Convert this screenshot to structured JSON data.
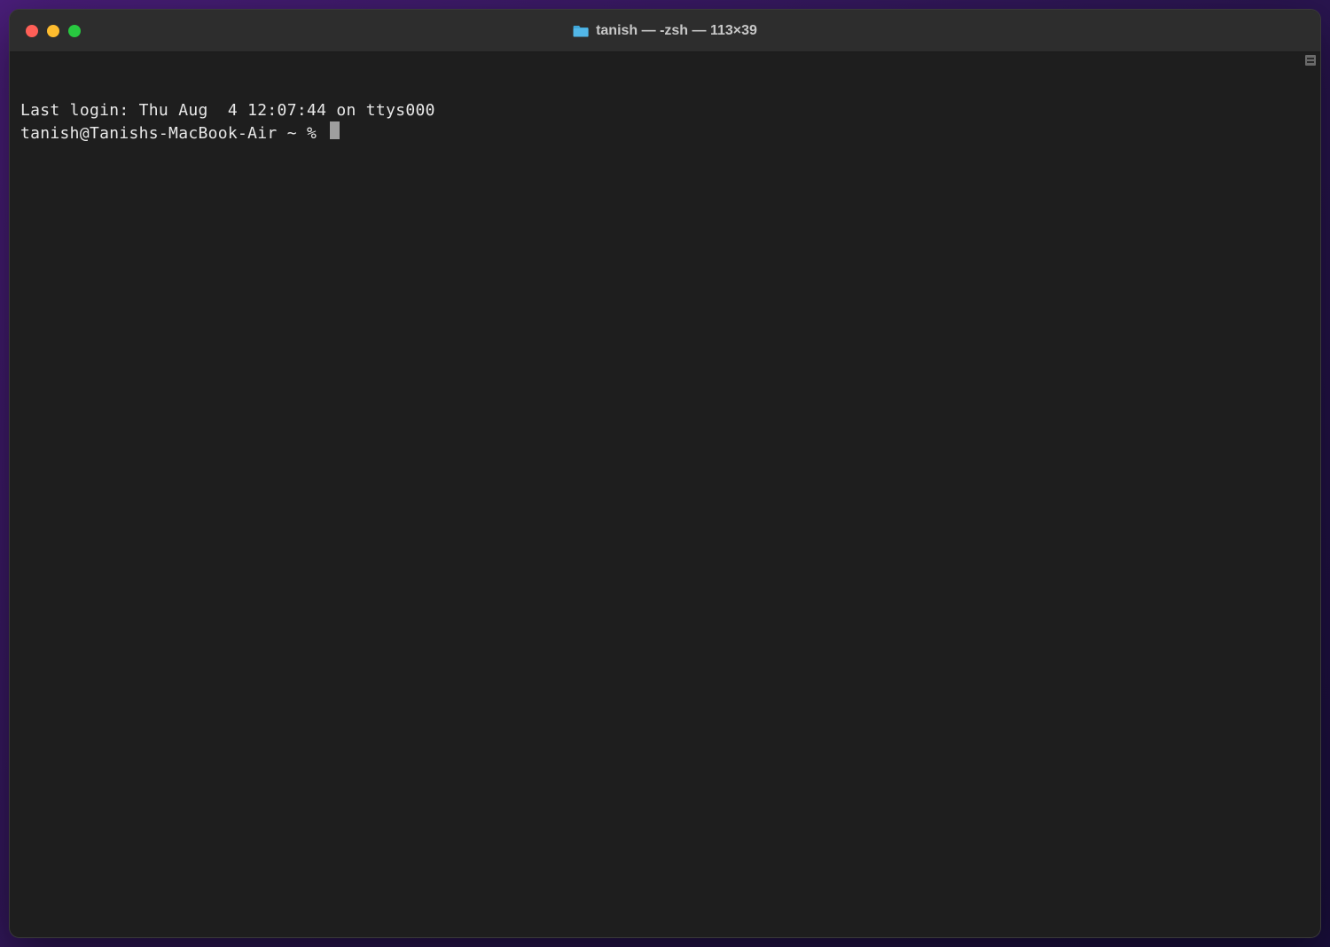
{
  "window": {
    "title": "tanish — -zsh — 113×39"
  },
  "terminal": {
    "last_login": "Last login: Thu Aug  4 12:07:44 on ttys000",
    "prompt": "tanish@Tanishs-MacBook-Air ~ % "
  },
  "colors": {
    "close": "#ff5f57",
    "minimize": "#febc2e",
    "zoom": "#28c840",
    "bg": "#1e1e1e",
    "titlebar": "#2d2d2d",
    "text": "#e8e8e8"
  }
}
